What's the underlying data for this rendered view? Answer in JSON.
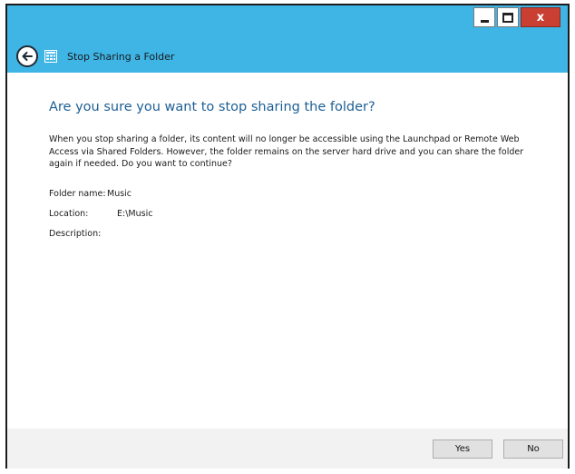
{
  "window": {
    "caption_buttons": {
      "minimize": "minimize-icon",
      "maximize": "maximize-icon",
      "close_glyph": "x"
    }
  },
  "nav": {
    "back_icon": "back-arrow-icon",
    "app_icon": "app-grid-icon",
    "title": "Stop Sharing a Folder"
  },
  "main": {
    "heading": "Are you sure you want to stop sharing the folder?",
    "description": "When you stop sharing a folder, its content will no longer be accessible using the Launchpad or Remote Web Access via Shared Folders. However, the folder remains on the server hard drive and you can share the folder again if needed. Do you want to continue?",
    "fields": [
      {
        "label": "Folder name:",
        "value": "Music"
      },
      {
        "label": "Location:",
        "value": "E:\\Music"
      },
      {
        "label": "Description:",
        "value": ""
      }
    ]
  },
  "footer": {
    "yes_label": "Yes",
    "no_label": "No"
  },
  "colors": {
    "title_bar": "#3fb5e6",
    "heading": "#1c5f95",
    "close_button": "#c94033"
  }
}
